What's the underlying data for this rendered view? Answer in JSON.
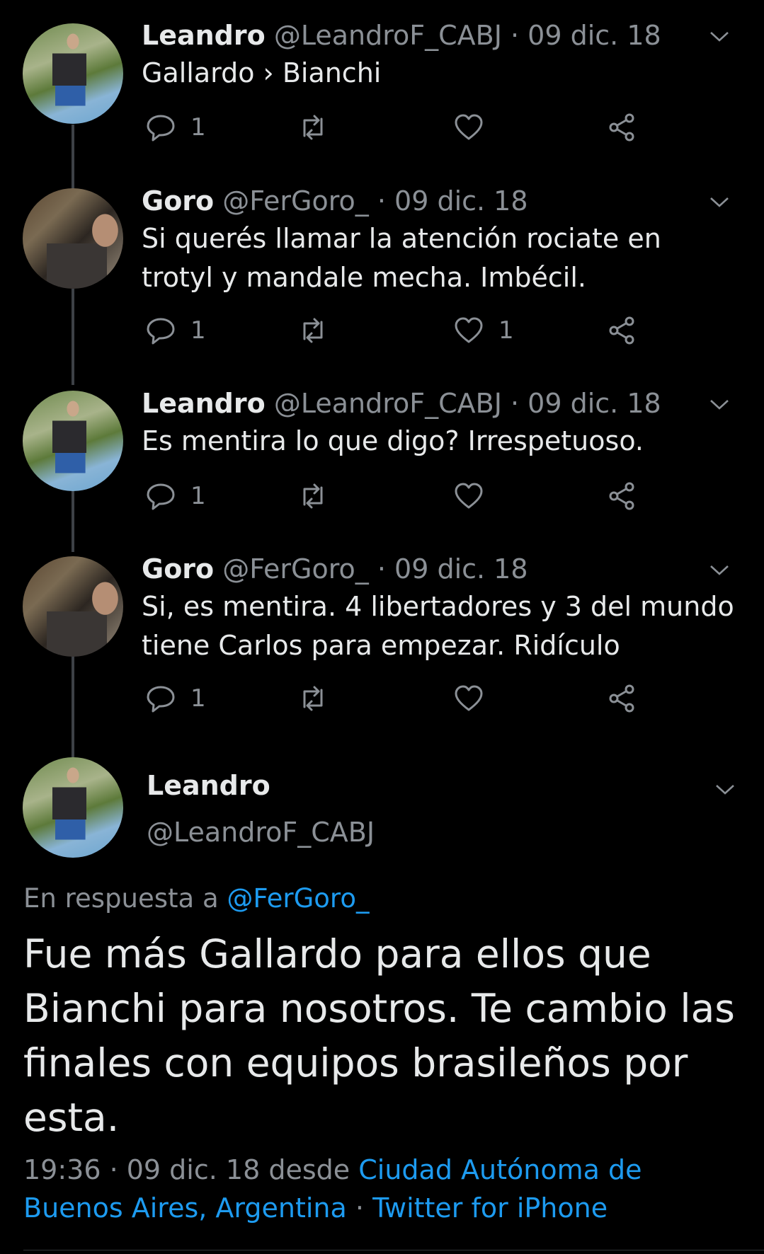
{
  "colors": {
    "background": "#000000",
    "text": "#e7e9ea",
    "muted": "#8b9096",
    "link": "#1d9bf0"
  },
  "tweets": [
    {
      "name": "Leandro",
      "handle": "@LeandroF_CABJ",
      "date": "· 09 dic. 18",
      "text": "Gallardo › Bianchi",
      "replies": "1",
      "retweets": "",
      "likes": ""
    },
    {
      "name": "Goro",
      "handle": "@FerGoro_",
      "date": "· 09 dic. 18",
      "text": "Si querés llamar la atención rociate en trotyl y mandale mecha. Imbécil.",
      "replies": "1",
      "retweets": "",
      "likes": "1"
    },
    {
      "name": "Leandro",
      "handle": "@LeandroF_CABJ",
      "date": "· 09 dic. 18",
      "text": "Es mentira lo que digo? Irrespetuoso.",
      "replies": "1",
      "retweets": "",
      "likes": ""
    },
    {
      "name": "Goro",
      "handle": "@FerGoro_",
      "date": "· 09 dic. 18",
      "text": "Si, es mentira. 4 libertadores y 3 del mundo tiene Carlos para empezar. Ridículo",
      "replies": "1",
      "retweets": "",
      "likes": ""
    }
  ],
  "main_tweet": {
    "name": "Leandro",
    "handle": "@LeandroF_CABJ",
    "reply_prefix": "En respuesta a",
    "reply_handle": "@FerGoro_",
    "text": "Fue más Gallardo para ellos que Bianchi para nosotros. Te cambio las finales con equipos brasileños por esta.",
    "time_date": "19:36 · 09 dic. 18 desde",
    "location": "Ciudad Autónoma de Buenos Aires, Argentina",
    "separator": "·",
    "client": "Twitter for iPhone"
  },
  "icons": [
    "reply-icon",
    "retweet-icon",
    "like-icon",
    "share-icon",
    "chevron-down-icon"
  ]
}
